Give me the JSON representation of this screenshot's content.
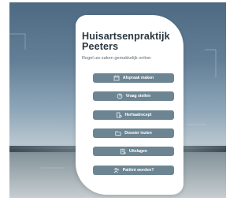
{
  "practice": {
    "title": "Huisartsenpraktijk Peeters",
    "subtitle": "Regel uw zaken gemakkelijk online:"
  },
  "menu": [
    {
      "label": "Afspraak maken",
      "icon": "calendar-icon"
    },
    {
      "label": "Vraag stellen",
      "icon": "question-icon"
    },
    {
      "label": "Herhaalrecept",
      "icon": "prescription-icon"
    },
    {
      "label": "Dossier inzien",
      "icon": "folder-icon"
    },
    {
      "label": "Uitslagen",
      "icon": "results-icon"
    },
    {
      "label": "Patiënt worden?",
      "icon": "add-patient-icon"
    }
  ],
  "colors": {
    "button": "#6d8592",
    "title": "#2b3740",
    "background_sky": "#637f97"
  }
}
